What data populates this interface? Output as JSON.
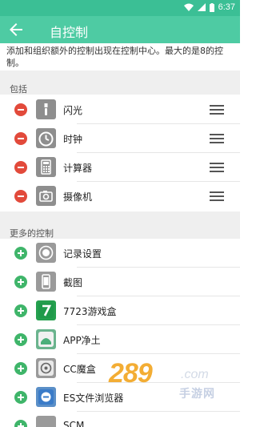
{
  "status": {
    "time": "6:37",
    "wifi_icon": "wifi-icon",
    "signal_icon": "signal-icon",
    "battery_icon": "battery-icon"
  },
  "header": {
    "title": "自控制",
    "back_icon": "arrow-left-icon"
  },
  "description": "添加和组织额外的控制出现在控制中心。最大的是8的控制。",
  "sections": {
    "included_label": "包括",
    "more_label": "更多的控制"
  },
  "included": [
    {
      "label": "闪光",
      "icon": "flashlight-icon"
    },
    {
      "label": "时钟",
      "icon": "timer-icon"
    },
    {
      "label": "计算器",
      "icon": "calculator-icon"
    },
    {
      "label": "摄像机",
      "icon": "camera-icon"
    }
  ],
  "more": [
    {
      "label": "记录设置",
      "icon": "record-icon"
    },
    {
      "label": "截图",
      "icon": "screenshot-icon"
    },
    {
      "label": "7723游戏盒",
      "icon": "app-7723-icon"
    },
    {
      "label": "APP净土",
      "icon": "android-app-icon"
    },
    {
      "label": "CC魔盒",
      "icon": "cc-box-icon"
    },
    {
      "label": "ES文件浏览器",
      "icon": "es-file-explorer-icon"
    },
    {
      "label": "SCM...",
      "icon": "app-icon"
    }
  ],
  "watermark": {
    "number": "289",
    "domain": ".com",
    "text": "手游网"
  },
  "colors": {
    "accent": "#4ecba3",
    "status_bar": "#3bbf95",
    "remove": "#e24a3b",
    "add": "#3fb56a"
  }
}
